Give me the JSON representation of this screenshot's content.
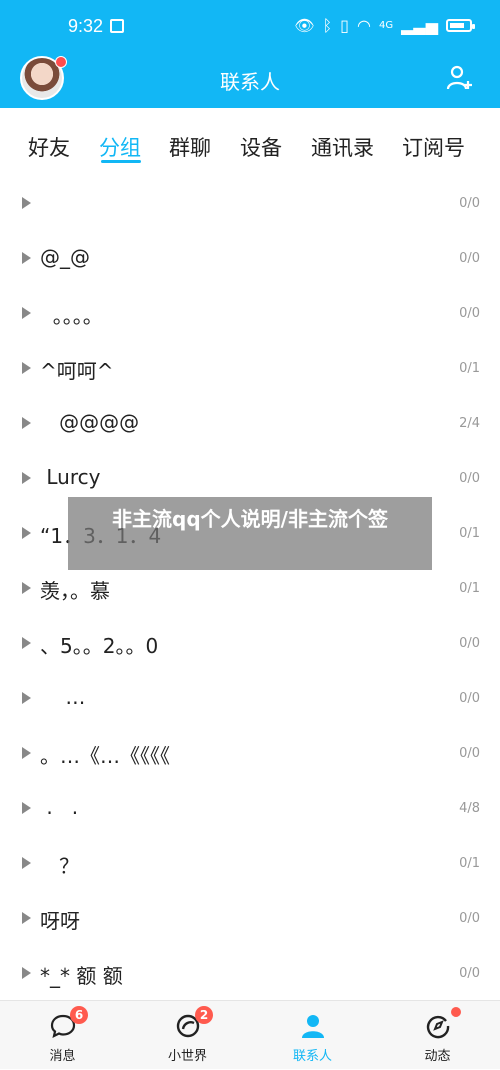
{
  "status": {
    "time": "9:32",
    "network": "4G"
  },
  "header": {
    "title": "联系人"
  },
  "tabs": [
    "好友",
    "分组",
    "群聊",
    "设备",
    "通讯录",
    "订阅号"
  ],
  "active_tab": "分组",
  "groups": [
    {
      "name": "",
      "count": "0/0"
    },
    {
      "name": "@_@",
      "count": "0/0"
    },
    {
      "name": "  。。。。",
      "count": "0/0"
    },
    {
      "name": "^呵呵^",
      "count": "0/1"
    },
    {
      "name": "   @@@@",
      "count": "2/4"
    },
    {
      "name": " Lurcy",
      "count": "0/0"
    },
    {
      "name": "“1．3．1．4",
      "count": "0/1"
    },
    {
      "name": "羡，。慕",
      "count": "0/1"
    },
    {
      "name": "、5。。2。。0",
      "count": "0/0"
    },
    {
      "name": "    …",
      "count": "0/0"
    },
    {
      "name": "。…《…《《《《",
      "count": "0/0"
    },
    {
      "name": " .   .",
      "count": "4/8"
    },
    {
      "name": "   ？",
      "count": "0/1"
    },
    {
      "name": "呀呀",
      "count": "0/0"
    },
    {
      "name": "*_* 额 额",
      "count": "0/0"
    }
  ],
  "overlay_text": "非主流qq个人说明/非主流个签",
  "bottom_nav": [
    {
      "label": "消息",
      "badge": "6"
    },
    {
      "label": "小世界",
      "badge": "2"
    },
    {
      "label": "联系人",
      "badge": ""
    },
    {
      "label": "动态",
      "badge": ""
    }
  ],
  "colors": {
    "accent": "#12b7f5",
    "badge": "#ff5a4e"
  }
}
